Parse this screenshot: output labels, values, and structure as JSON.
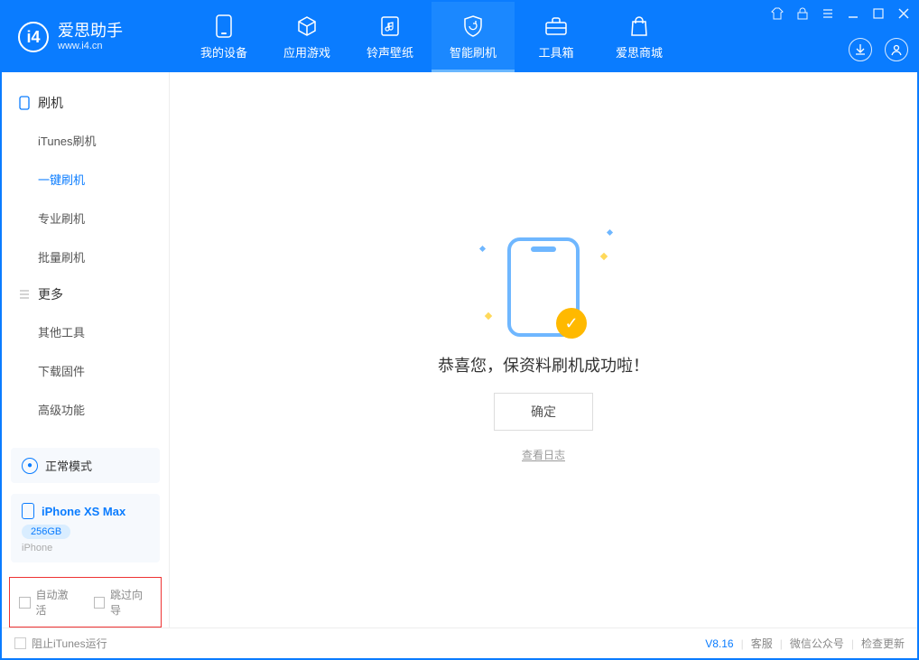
{
  "app": {
    "title": "爱思助手",
    "subtitle": "www.i4.cn"
  },
  "nav": {
    "tabs": [
      {
        "label": "我的设备"
      },
      {
        "label": "应用游戏"
      },
      {
        "label": "铃声壁纸"
      },
      {
        "label": "智能刷机"
      },
      {
        "label": "工具箱"
      },
      {
        "label": "爱思商城"
      }
    ]
  },
  "sidebar": {
    "group1_title": "刷机",
    "group1_items": [
      "iTunes刷机",
      "一键刷机",
      "专业刷机",
      "批量刷机"
    ],
    "group2_title": "更多",
    "group2_items": [
      "其他工具",
      "下载固件",
      "高级功能"
    ]
  },
  "mode_card": {
    "label": "正常模式"
  },
  "device": {
    "name": "iPhone XS Max",
    "storage": "256GB",
    "type": "iPhone"
  },
  "options": {
    "auto_activate": "自动激活",
    "skip_guide": "跳过向导"
  },
  "main": {
    "success_text": "恭喜您，保资料刷机成功啦！",
    "confirm_label": "确定",
    "view_log": "查看日志"
  },
  "footer": {
    "block_itunes": "阻止iTunes运行",
    "version": "V8.16",
    "links": [
      "客服",
      "微信公众号",
      "检查更新"
    ]
  }
}
